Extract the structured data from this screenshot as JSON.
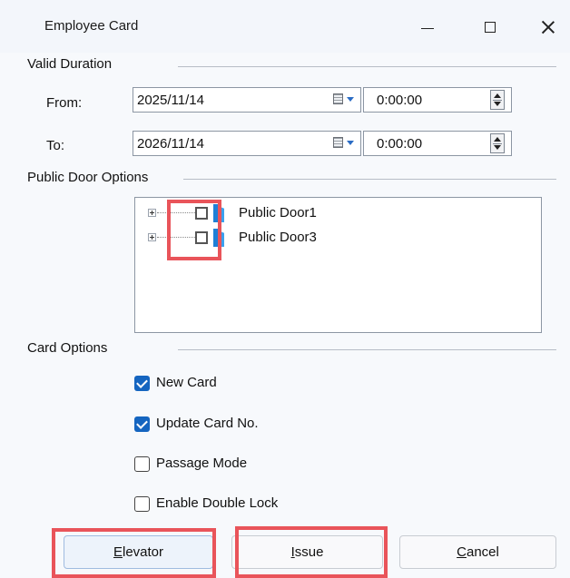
{
  "window": {
    "title": "Employee Card"
  },
  "valid_duration": {
    "label": "Valid Duration",
    "from": {
      "label": "From:",
      "date": "2025/11/14",
      "time": "0:00:00"
    },
    "to": {
      "label": "To:",
      "date": "2026/11/14",
      "time": "0:00:00"
    }
  },
  "public_doors": {
    "label": "Public Door Options",
    "items": [
      {
        "name": "Public Door1",
        "checked": false
      },
      {
        "name": "Public Door3",
        "checked": false
      }
    ]
  },
  "card_options": {
    "label": "Card Options",
    "items": [
      {
        "label": "New Card",
        "checked": true
      },
      {
        "label": "Update Card No.",
        "checked": true
      },
      {
        "label": "Passage Mode",
        "checked": false
      },
      {
        "label": "Enable Double Lock",
        "checked": false
      }
    ]
  },
  "buttons": {
    "elevator": {
      "accel": "E",
      "rest": "levator"
    },
    "issue": {
      "accel": "I",
      "rest": "ssue"
    },
    "cancel": {
      "accel": "C",
      "rest": "ancel"
    }
  },
  "colors": {
    "highlight": "#e9545a",
    "checkbox_checked": "#1565c0",
    "door_icon": "#1e7fd6"
  },
  "icons": [
    "minimize-icon",
    "maximize-icon",
    "close-icon",
    "calendar-icon",
    "spin-icon",
    "expand-icon",
    "door-icon"
  ]
}
